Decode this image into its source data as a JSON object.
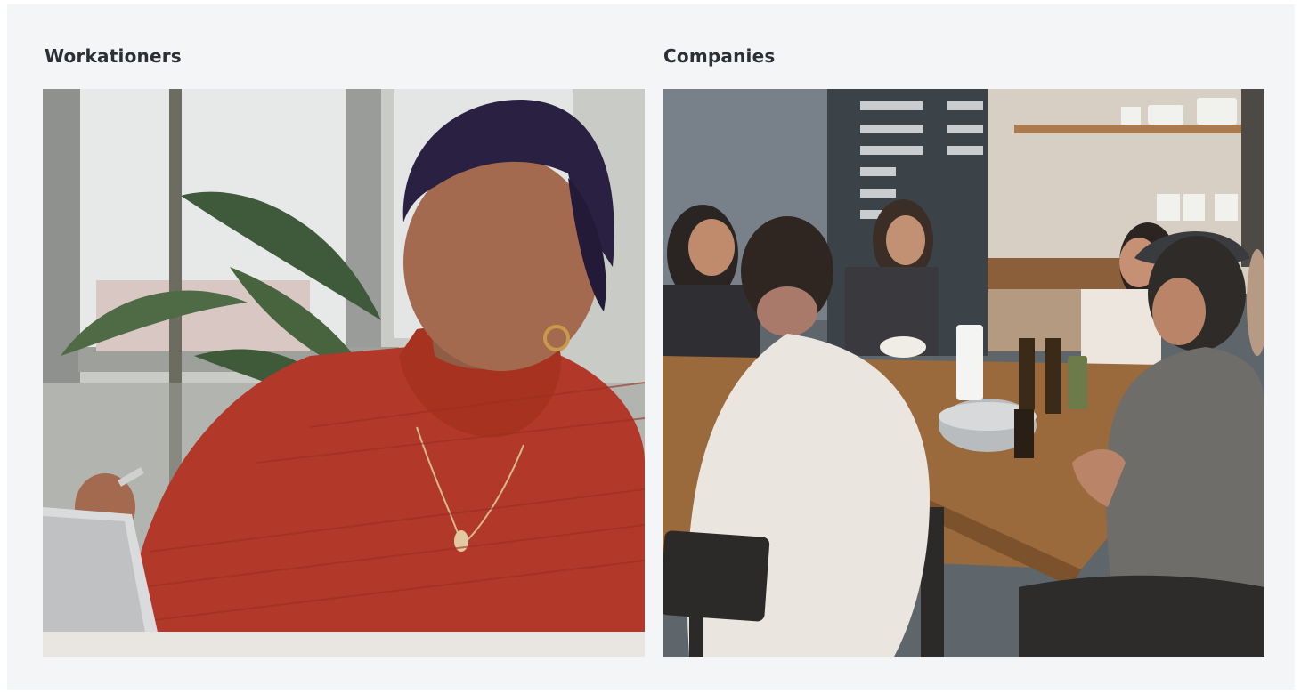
{
  "sections": [
    {
      "title": "Workationers",
      "image_subject": "woman-with-tablet-photo"
    },
    {
      "title": "Companies",
      "image_subject": "team-meeting-at-table-photo"
    }
  ],
  "colors": {
    "background": "#f4f5f7",
    "title_text": "#2c2f36",
    "sweater": "#b2392a",
    "table_wood": "#9a6a3c"
  }
}
